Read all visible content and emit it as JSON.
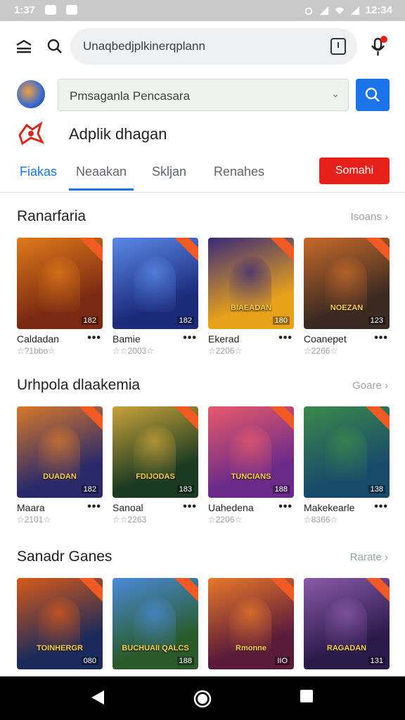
{
  "status_bar": {
    "time_left": "1:37",
    "time_right": "12:34"
  },
  "top_bar": {
    "url_text": "Unaqbedjplkinerqplann"
  },
  "search_row": {
    "dropdown_text": "Pmsaganla Pencasara"
  },
  "app_row": {
    "title": "Adplik  dhagan"
  },
  "tabs": [
    {
      "label": "Fiakas",
      "active": true
    },
    {
      "label": "Neaakan",
      "active": false
    },
    {
      "label": "Skljan",
      "active": false
    },
    {
      "label": "Renahes",
      "active": false
    }
  ],
  "action_button": {
    "label": "Somahi"
  },
  "sections": [
    {
      "title": "Ranarfaria",
      "more": "Isoans",
      "cards": [
        {
          "name": "Caldadan",
          "stars": "☆?1bbo☆",
          "rating": "182",
          "logo": "",
          "colors": [
            "#7a2a12",
            "#e07a1a"
          ]
        },
        {
          "name": "Bamie",
          "stars": "☆☆2003☆",
          "rating": "182",
          "logo": "",
          "colors": [
            "#1c2a7a",
            "#5a8ae8"
          ]
        },
        {
          "name": "Ekerad",
          "stars": "☆2206☆",
          "rating": "180",
          "logo": "BIAEADAN",
          "colors": [
            "#e8a21a",
            "#3a2a7a"
          ]
        },
        {
          "name": "Coanepet",
          "stars": "☆2266☆",
          "rating": "123",
          "logo": "NOEZAN",
          "colors": [
            "#3a2a22",
            "#c86a2a"
          ]
        }
      ]
    },
    {
      "title": "Urhpola dlaakemia",
      "more": "Goare",
      "cards": [
        {
          "name": "Maara",
          "stars": "☆2101☆",
          "rating": "182",
          "logo": "DUADAN",
          "colors": [
            "#2a2a6a",
            "#d8782a"
          ]
        },
        {
          "name": "Sanoal",
          "stars": "☆☆2263",
          "rating": "183",
          "logo": "FDIJODAS",
          "colors": [
            "#1a3a22",
            "#c8a23a"
          ]
        },
        {
          "name": "Uahedena",
          "stars": "☆2206☆",
          "rating": "188",
          "logo": "TUNCIANS",
          "colors": [
            "#6a2a8a",
            "#e85a6a"
          ]
        },
        {
          "name": "Makekearle",
          "stars": "☆8366☆",
          "rating": "138",
          "logo": "",
          "colors": [
            "#1a4a6a",
            "#3a8a4a"
          ]
        }
      ]
    },
    {
      "title": "Sanadr Ganes",
      "more": "Rarate",
      "cards": [
        {
          "name": "",
          "stars": "",
          "rating": "080",
          "logo": "TOINHERGR",
          "colors": [
            "#1a2a5a",
            "#d85a1a"
          ]
        },
        {
          "name": "",
          "stars": "",
          "rating": "188",
          "logo": "BUCHUAII QALCS",
          "colors": [
            "#2a5a2a",
            "#4a8ad8"
          ]
        },
        {
          "name": "",
          "stars": "",
          "rating": "IIO",
          "logo": "Rmonne",
          "colors": [
            "#5a1a3a",
            "#e8782a"
          ]
        },
        {
          "name": "",
          "stars": "",
          "rating": "131",
          "logo": "RAGADAN",
          "colors": [
            "#2a1a4a",
            "#8a5aa8"
          ]
        }
      ]
    }
  ],
  "icons": {
    "menu": "menu-icon",
    "search": "search-icon",
    "mic": "mic-icon",
    "tabs": "tab-switcher-icon",
    "chevron": "chevron-down-icon",
    "back": "back-icon",
    "home": "home-icon",
    "recents": "recents-icon"
  },
  "colors": {
    "accent": "#1a73e8",
    "danger": "#e8201a"
  }
}
